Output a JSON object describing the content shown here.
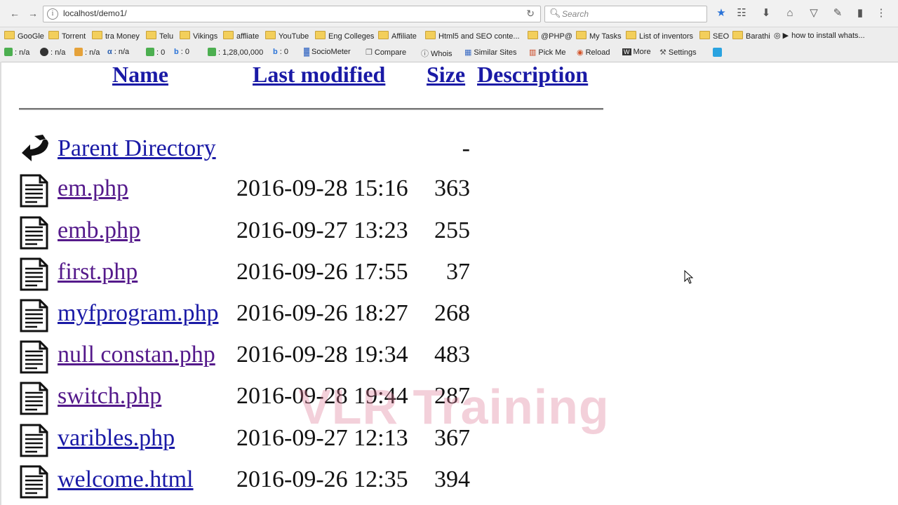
{
  "browser": {
    "url": "localhost/demo1/",
    "search_placeholder": "Search",
    "bookmarks": [
      "GooGle",
      "Torrent",
      "tra Money",
      "Telu",
      "Vikings",
      "affliate",
      "YouTube",
      "Eng Colleges",
      "Affiliate",
      "Html5 and SEO  conte...",
      "@PHP@",
      "My Tasks",
      "List of inventors",
      "SEO",
      "Barathi",
      "how to install whats..."
    ],
    "seo_toolbar": {
      "pr1": ": n/a",
      "pr2": ": n/a",
      "pr3": ": n/a",
      "pr4": ": n/a",
      "g1": ": 0",
      "b1": ": 0",
      "g2": ": 1,28,00,000",
      "b2": ": 0",
      "items": [
        "SocioMeter",
        "Compare",
        "Whois",
        "Similar Sites",
        "Pick Me",
        "Reload",
        "More",
        "Settings"
      ]
    }
  },
  "listing": {
    "headers": {
      "name": "Name",
      "modified": "Last modified",
      "size": "Size",
      "description": "Description"
    },
    "parent": {
      "label": "Parent Directory",
      "size": "-"
    },
    "files": [
      {
        "name": "em.php",
        "modified": "2016-09-28 15:16",
        "size": "363"
      },
      {
        "name": "emb.php",
        "modified": "2016-09-27 13:23",
        "size": "255"
      },
      {
        "name": "first.php",
        "modified": "2016-09-26 17:55",
        "size": "37"
      },
      {
        "name": "myfprogram.php",
        "modified": "2016-09-26 18:27",
        "size": "268"
      },
      {
        "name": "null constan.php",
        "modified": "2016-09-28 19:34",
        "size": "483"
      },
      {
        "name": "switch.php",
        "modified": "2016-09-28 19:44",
        "size": "287"
      },
      {
        "name": "varibles.php",
        "modified": "2016-09-27 12:13",
        "size": "367"
      },
      {
        "name": "welcome.html",
        "modified": "2016-09-26 12:35",
        "size": "394"
      }
    ]
  },
  "watermark": "VLR Training",
  "colors": {
    "link": "#1a1aa6",
    "visited": "#551a8b",
    "folder": "#f3cf5b"
  }
}
